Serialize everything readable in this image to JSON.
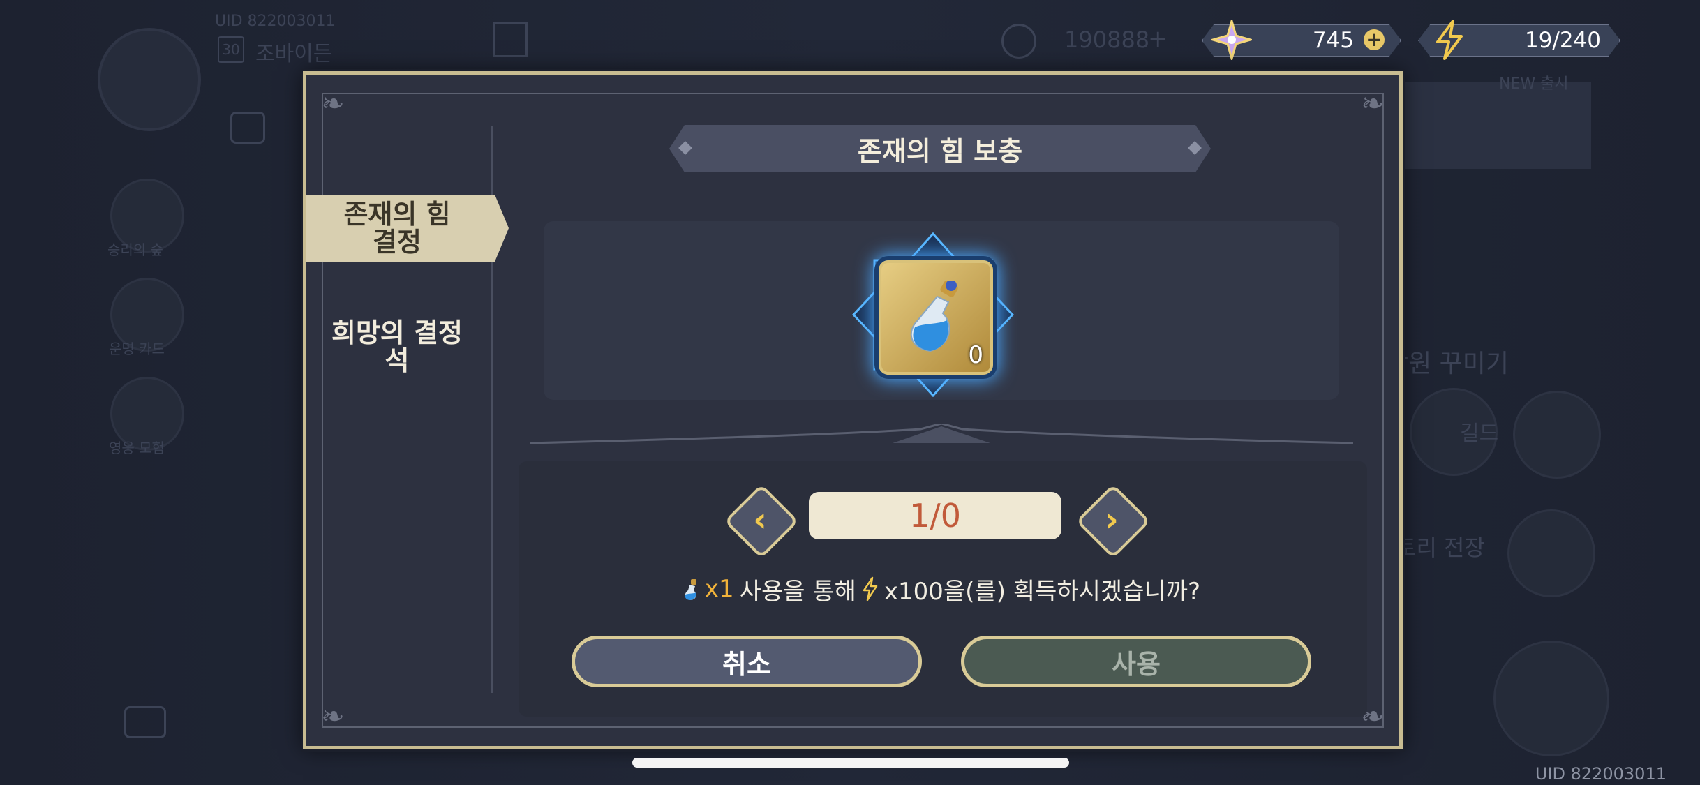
{
  "background": {
    "uid_top": "UID 822003011",
    "level": "30",
    "player_name": "조바이든",
    "gold": "190888",
    "gold_plus": "+",
    "side_labels": [
      "승리의 숲",
      "운명 카드",
      "영웅 모험"
    ],
    "new_label": "NEW 출시",
    "decor_label": "장원 꾸미기",
    "guild_label": "길드",
    "battle_label": "토리 전장",
    "bottom_uid": "UID 822003011"
  },
  "currency": {
    "gems": "745",
    "gems_plus": "+",
    "stamina": "19/240"
  },
  "dialog": {
    "title": "존재의 힘 보충",
    "tabs": [
      {
        "label": "존재의 힘 결정",
        "active": true
      },
      {
        "label": "희망의 결정석",
        "active": false
      }
    ],
    "item": {
      "icon": "blue-potion-icon",
      "count": "0"
    },
    "counter": "1/0",
    "message": {
      "qty": "x1",
      "text1": "사용을 통해",
      "amount": "x100을(를) 획득하시겠습니까?"
    },
    "cancel_label": "취소",
    "use_label": "사용"
  },
  "colors": {
    "frame": "#c8bc91",
    "accent_orange": "#f0b23a",
    "counter_text": "#c15a3a",
    "tab_active_bg": "#d8cfb0"
  }
}
